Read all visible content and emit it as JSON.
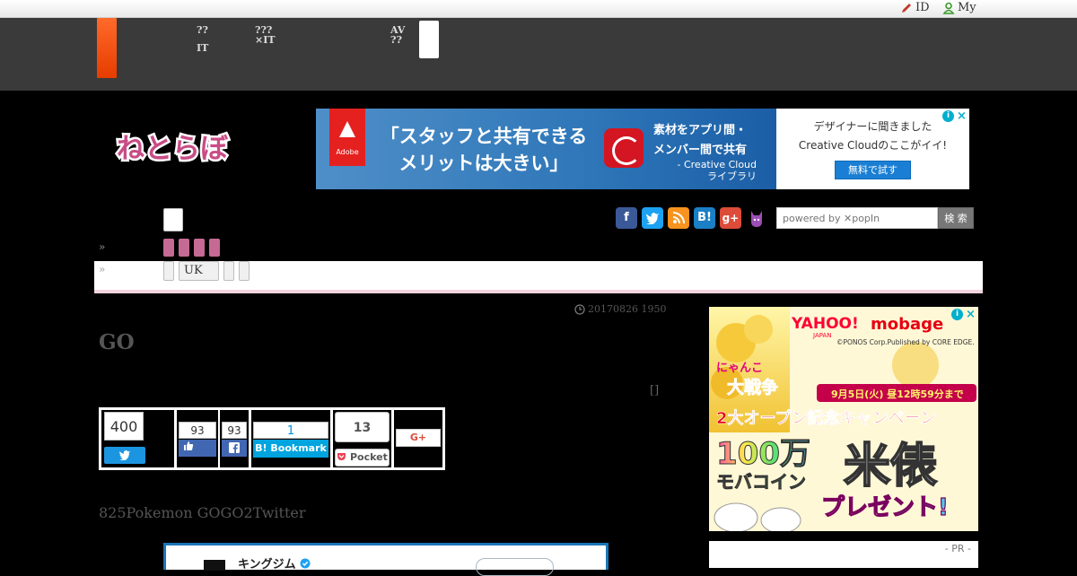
{
  "toplinks": {
    "id_label": "ID",
    "my_label": "My"
  },
  "header": {
    "nav": [
      {
        "line1": "??",
        "line2": "IT"
      },
      {
        "line1": "???",
        "line2": "×IT"
      },
      {
        "line1": "AV",
        "line2": "??"
      }
    ]
  },
  "logo": {
    "text": "ねとらぼ"
  },
  "ad_top": {
    "brand": "Adobe",
    "headline1": "「スタッフと共有できる",
    "headline2": "メリットは大きい」",
    "mid1": "素材をアプリ間・",
    "mid2": "メンバー間で共有",
    "mid3": "- Creative Cloud",
    "mid4": "ライブラリ",
    "right1": "デザイナーに聞きました",
    "right2": "Creative Cloudのここがイイ!",
    "cta": "無料で試す"
  },
  "nav": {
    "arrow1": "»",
    "arrow2": "»",
    "sub_tags": [
      "",
      "UK",
      "",
      ""
    ]
  },
  "social": {
    "icons": [
      "facebook-icon",
      "twitter-icon",
      "rss-icon",
      "hatena-icon",
      "googleplus-icon",
      "cat-icon"
    ]
  },
  "search": {
    "placeholder": "powered by ✕popIn",
    "button": "検 索"
  },
  "article": {
    "datetime": "20170826 1950",
    "title": "GO",
    "bracket": "[]",
    "lead": "825Pokemon GOGO2Twitter"
  },
  "share": {
    "twitter_count": "400",
    "like_count": "93",
    "fb_share_count": "93",
    "hatena_count": "1",
    "hatena_label": "Bookmark",
    "pocket_count": "13",
    "pocket_label": "Pocket",
    "gplus_label": "G+"
  },
  "tweet": {
    "name": "キングジム"
  },
  "ad_side": {
    "yahoo": "YAHOO!",
    "japan": "JAPAN",
    "mobage": "mobage",
    "copyright": "©PONOS Corp.Published by CORE EDGE.",
    "game_title1": "にゃんこ",
    "game_title2": "大戦争",
    "date_line": "9月5日(火) 昼12時59分まで",
    "campaign": "2大オープン記念キャンペーン",
    "prize1": "100万",
    "prize2": "モバコイン",
    "prize3": "米俵",
    "present": "プレゼント!"
  },
  "pr": {
    "label": "- PR -"
  }
}
